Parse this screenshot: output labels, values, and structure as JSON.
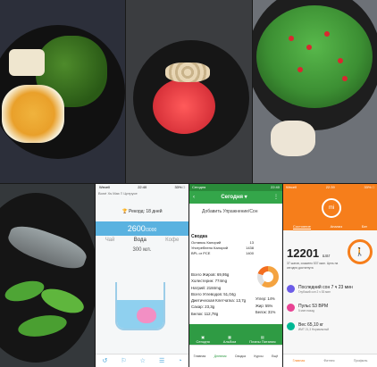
{
  "water_app": {
    "status_left": "Wecell",
    "status_time": "22:40",
    "status_right": "33% □",
    "header": "Boné Xs Max ≡ Цитрусe",
    "record": "🏆 Рекорд: 18 дней",
    "amount": "2600",
    "amount_total": "/3000",
    "tabs": [
      "Чай",
      "Вода",
      "Кофе"
    ],
    "active_tab": "Вода",
    "volume": "300 мл.",
    "nav_icons": [
      "↺",
      "⚐",
      "☆",
      "☰",
      "◔"
    ]
  },
  "food_app": {
    "status_left": "Сегодня",
    "status_right": "22:40",
    "title": "Сегодня ▾",
    "add_label": "Добавить Упражнение/Сон",
    "summary_title": "Сводка",
    "rows": [
      {
        "label": "Остаюсь Калорий",
        "value": "13"
      },
      {
        "label": "Употреблено Калорий",
        "value": "1438"
      },
      {
        "label": "BPL or PCE",
        "value": "1400"
      }
    ],
    "nutrients": [
      "Всего Жиров: 69,95g",
      "Холестерин: 774mg",
      "Натрий: 2184mg",
      "Всего Углеводов: 51,04g",
      "Диетическая Клетчатка: 13,7g",
      "Сахар: 23,3g",
      "Белок: 112,78g"
    ],
    "percents": [
      "Углер: 14%",
      "Жир: 55%",
      "Белок: 31%"
    ],
    "bottom_actions": [
      "Сегодня",
      "Альбом",
      "Планы Питания"
    ],
    "nav": [
      "Главная",
      "Дневник",
      "Сводка",
      "Курсы",
      "Ещё"
    ]
  },
  "fitness_app": {
    "status_left": "Wecell",
    "status_time": "22:39",
    "status_right": "33% □",
    "logo": "mi",
    "tabs": [
      "Состояние",
      "Анализ",
      "Бег"
    ],
    "steps": "12201",
    "steps_unit": "шаг",
    "ring_icon": "🚶",
    "sub_text": "37 шагов, сожжено 537 ккал. Цель на сегодня достигнута",
    "cards": [
      {
        "title": "Последний сон 7 ч 23 мин",
        "sub": "Глубокий сон 2 ч 53 мин",
        "color": "#6c5ce7"
      },
      {
        "title": "Пульс 53 BPM",
        "sub": "5 мин назад",
        "color": "#e84393"
      },
      {
        "title": "Вес 65,10 кг",
        "sub": "ИМТ 21,3 Нормальный",
        "color": "#00b894"
      }
    ],
    "nav": [
      "Главная",
      "Фитнес",
      "Профиль"
    ]
  }
}
